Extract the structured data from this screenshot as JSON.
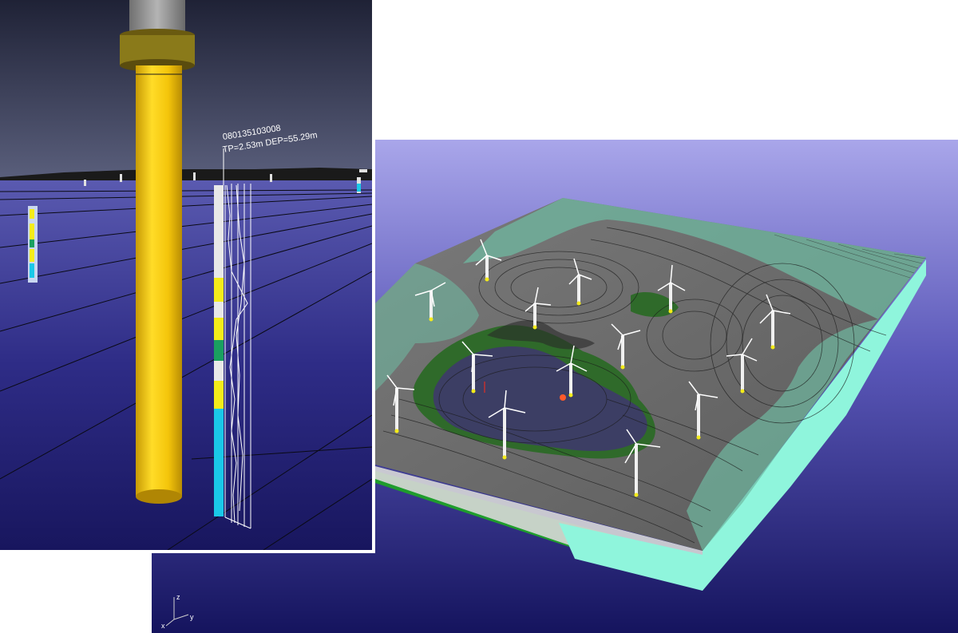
{
  "borehole": {
    "id": "080135103008",
    "info": "TP=2.53m DEP=55.29m"
  },
  "axes": {
    "z": "z",
    "x": "x",
    "y": "y"
  },
  "colors": {
    "sky_top": "#2a2d4a",
    "water_bottom": "#1a1860",
    "right_bg_top": "#a7a4e8",
    "right_bg_bottom": "#1c1b6a",
    "monopile": "#f3c60a",
    "collar": "#8a7a1a",
    "terrain_grey": "#6d6d6d",
    "terrain_green": "#2f6a2a",
    "terrain_teal": "#6fb8a0",
    "scour_pit": "#3c3e64",
    "slab_side": "#8ff5dc",
    "slab_green": "#1f9d2c",
    "layer_yellow": "#f4ec1a",
    "layer_green": "#1aa060",
    "layer_cyan": "#1ac8e8",
    "layer_white": "#e8e8e8"
  }
}
